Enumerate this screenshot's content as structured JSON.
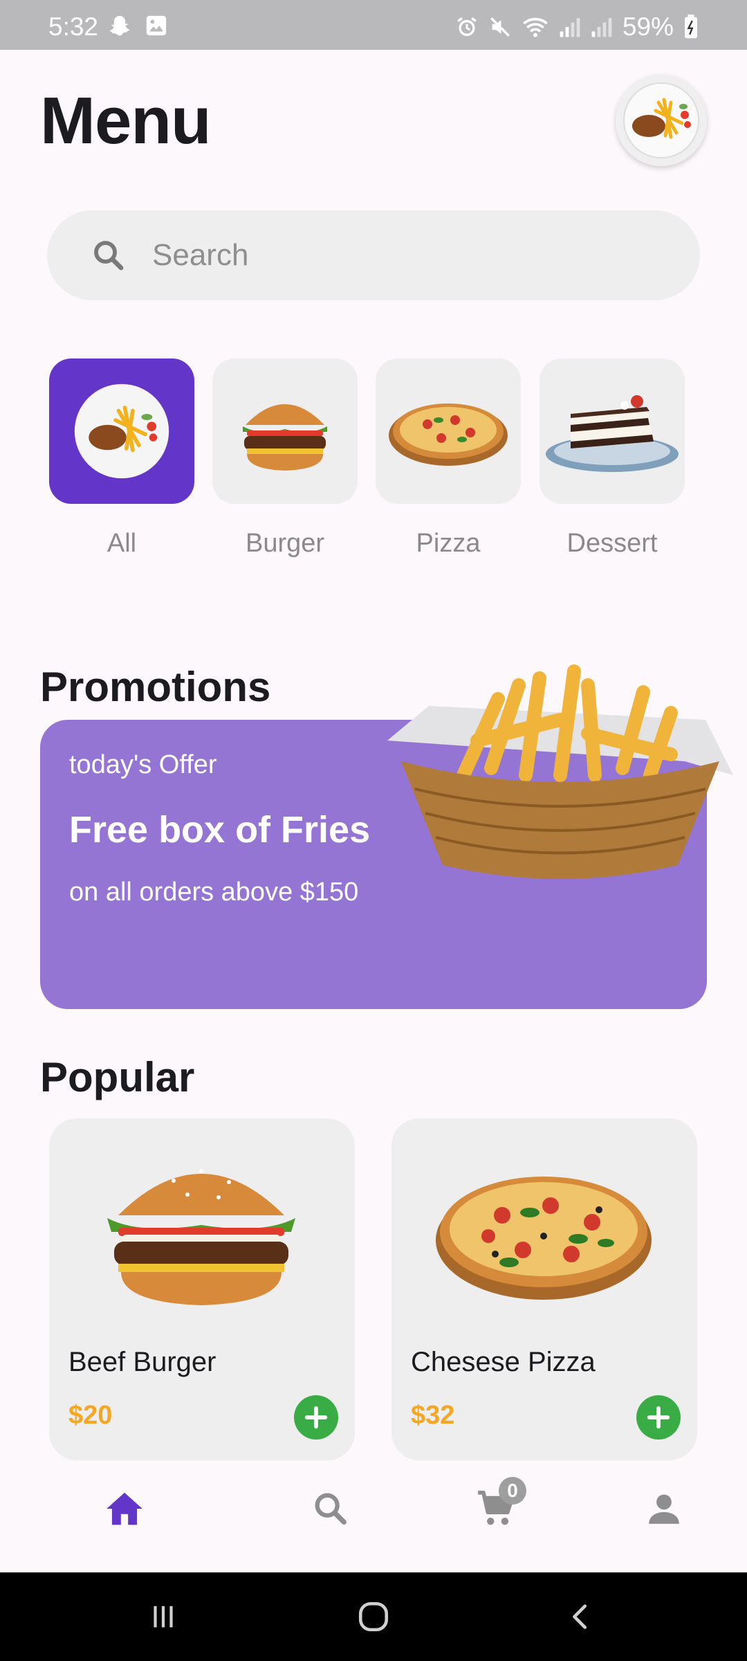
{
  "status_bar": {
    "time": "5:32",
    "battery": "59%",
    "left_icons": [
      "snapchat-icon",
      "gallery-icon"
    ],
    "right_icons": [
      "alarm-icon",
      "mute-icon",
      "wifi-icon",
      "signal-icon",
      "signal-icon",
      "battery-icon"
    ]
  },
  "header": {
    "title": "Menu"
  },
  "search": {
    "placeholder": "Search"
  },
  "categories": [
    {
      "label": "All",
      "active": true
    },
    {
      "label": "Burger",
      "active": false
    },
    {
      "label": "Pizza",
      "active": false
    },
    {
      "label": "Dessert",
      "active": false
    }
  ],
  "promotions": {
    "title": "Promotions",
    "kicker": "today's Offer",
    "headline": "Free box of Fries",
    "subtext": "on all orders above $150"
  },
  "popular": {
    "title": "Popular",
    "items": [
      {
        "name": "Beef Burger",
        "price": "$20"
      },
      {
        "name": "Chesese Pizza",
        "price": "$32"
      }
    ]
  },
  "bottom_nav": {
    "items": [
      "home-icon",
      "search-icon",
      "cart-icon",
      "profile-icon"
    ],
    "cart_count": "0"
  },
  "colors": {
    "accent": "#6435c9",
    "promo": "#9575d4",
    "price": "#f5a623",
    "add": "#3aac45"
  }
}
